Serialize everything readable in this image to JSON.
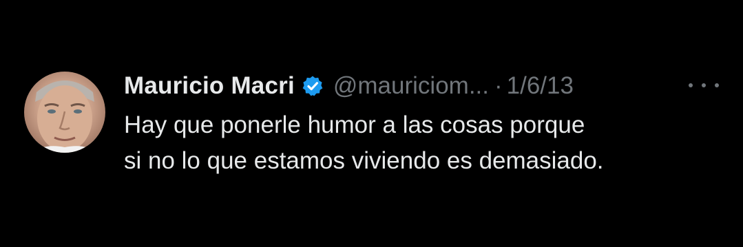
{
  "tweet": {
    "author": {
      "name": "Mauricio Macri",
      "handle": "@mauriciom...",
      "verified": true,
      "avatar_icon": "profile-photo"
    },
    "separator": "·",
    "date": "1/6/13",
    "more_icon": "ellipsis-horizontal-icon",
    "text_lines": [
      "Hay que ponerle humor a las cosas porque",
      "si no lo que estamos viviendo es demasiado."
    ]
  },
  "colors": {
    "background": "#000000",
    "primary_text": "#e7e9ea",
    "secondary_text": "#71767b",
    "verified_badge": "#1d9bf0"
  }
}
